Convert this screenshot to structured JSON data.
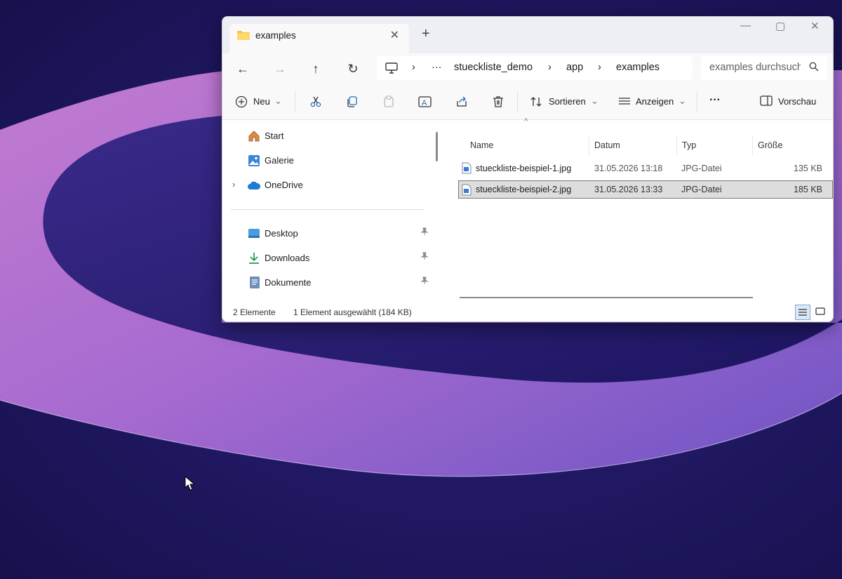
{
  "window": {
    "tab_title": "examples",
    "new_tab_symbol": "+",
    "icons": [
      "folder-icon",
      "close-icon",
      "minimize-icon",
      "maximize-icon"
    ]
  },
  "navigation": {
    "breadcrumb": [
      "stueckliste_demo",
      "app",
      "examples"
    ],
    "overflow": "···",
    "search_placeholder": "examples durchsuchen"
  },
  "toolbar": {
    "new_label": "Neu",
    "sort_label": "Sortieren",
    "view_label": "Anzeigen",
    "more_label": "···",
    "preview_label": "Vorschau"
  },
  "sidebar": {
    "items": [
      {
        "label": "Start",
        "icon": "home-icon"
      },
      {
        "label": "Galerie",
        "icon": "gallery-icon"
      },
      {
        "label": "OneDrive",
        "icon": "cloud-icon"
      },
      {
        "label": "Desktop",
        "icon": "desktop-icon",
        "pinned": true
      },
      {
        "label": "Downloads",
        "icon": "download-icon",
        "pinned": true
      },
      {
        "label": "Dokumente",
        "icon": "documents-icon",
        "pinned": true
      }
    ]
  },
  "file_list": {
    "columns": [
      "Name",
      "Datum",
      "Typ",
      "Größe"
    ],
    "rows": [
      {
        "name": "stueckliste-beispiel-1.jpg",
        "date": "31.05.2026 13:18",
        "type": "JPG-Datei",
        "size": "135 KB",
        "selected": false
      },
      {
        "name": "stueckliste-beispiel-2.jpg",
        "date": "31.05.2026 13:33",
        "type": "JPG-Datei",
        "size": "185 KB",
        "selected": true
      }
    ]
  },
  "status_bar": {
    "count": "2 Elemente",
    "selection": "1 Element ausgewählt (184 KB)"
  },
  "colors": {
    "desktop_dark": "#1d1550",
    "ribbon_pink": "#b772c4",
    "ribbon_violet": "#7a4fbf",
    "selection": "#dddddd"
  }
}
